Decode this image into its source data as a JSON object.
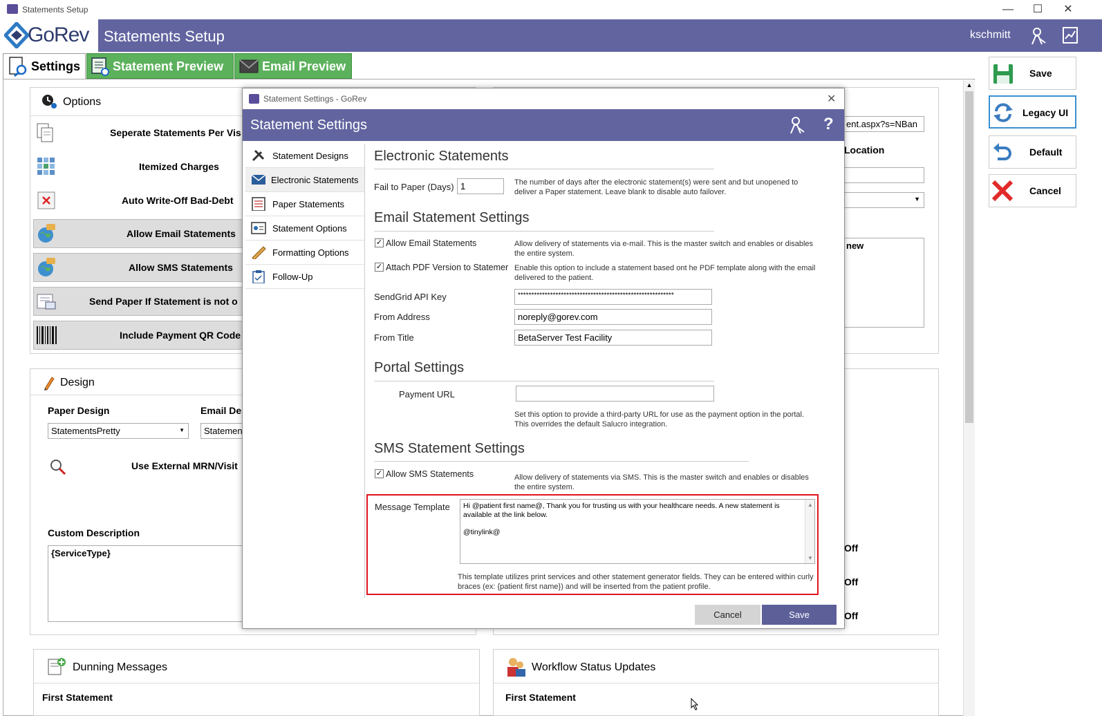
{
  "window": {
    "title": "Statements Setup",
    "min": "—",
    "max": "☐",
    "close": "✕"
  },
  "app": {
    "logo": "GoRev",
    "title": "Statements Setup",
    "username": "kschmitt"
  },
  "tabs": [
    {
      "label": "Settings"
    },
    {
      "label": "Statement Preview"
    },
    {
      "label": "Email Preview"
    }
  ],
  "options_panel": {
    "title": "Options",
    "items": [
      {
        "label": "Seperate Statements Per Vis"
      },
      {
        "label": "Itemized Charges"
      },
      {
        "label": "Auto Write-Off Bad-Debt"
      },
      {
        "label": "Allow Email Statements"
      },
      {
        "label": "Allow SMS Statements"
      },
      {
        "label": "Send Paper If Statement is not o"
      },
      {
        "label": "Include Payment QR Code"
      }
    ]
  },
  "design_panel": {
    "title": "Design",
    "paper_design_label": "Paper Design",
    "paper_design_value": "StatementsPretty",
    "email_design_label": "Email Des",
    "email_design_value": "Statemen",
    "external_mrn_label": "Use External MRN/Visit",
    "custom_description_label": "Custom Description",
    "custom_description_value": "{ServiceType}"
  },
  "right_partial": {
    "url_value": "ent.aspx?s=NBan",
    "location_label": "Location",
    "textarea_fragment": "new",
    "off1": "Off",
    "off2": "Off",
    "off3": "Off"
  },
  "dunning": {
    "title": "Dunning Messages",
    "first": "First Statement"
  },
  "workflow": {
    "title": "Workflow Status Updates",
    "first": "First Statement"
  },
  "side_buttons": {
    "save": "Save",
    "legacy": "Legacy UI",
    "default": "Default",
    "cancel": "Cancel"
  },
  "dialog": {
    "window_title": "Statement Settings - GoRev",
    "header": "Statement Settings",
    "help": "?",
    "nav": [
      {
        "label": "Statement Designs"
      },
      {
        "label": "Electronic Statements"
      },
      {
        "label": "Paper Statements"
      },
      {
        "label": "Statement Options"
      },
      {
        "label": "Formatting Options"
      },
      {
        "label": "Follow-Up"
      }
    ],
    "electronic": {
      "title": "Electronic Statements",
      "fail_label": "Fail to Paper (Days)",
      "fail_value": "1",
      "fail_help": "The number of days after the electronic statement(s) were sent and but unopened to deliver a Paper statement. Leave blank to disable auto failover."
    },
    "email": {
      "title": "Email Statement Settings",
      "allow_label": "Allow Email Statements",
      "allow_help": "Allow delivery of statements via e-mail. This is the master switch and enables or disables the entire system.",
      "pdf_label": "Attach PDF Version to Statemer",
      "pdf_help": "Enable this option to include a statement based ont he PDF template along with the email delivered to the patient.",
      "sendgrid_label": "SendGrid API Key",
      "sendgrid_value": "**********************************************************",
      "from_address_label": "From Address",
      "from_address_value": "noreply@gorev.com",
      "from_title_label": "From Title",
      "from_title_value": "BetaServer Test Facility"
    },
    "portal": {
      "title": "Portal Settings",
      "payment_label": "Payment URL",
      "payment_value": "",
      "payment_help": "Set this option to provide a third-party URL for use as the payment option in the portal. This overrides the default Salucro integration."
    },
    "sms": {
      "title": "SMS Statement Settings",
      "allow_label": "Allow SMS Statements",
      "allow_help": "Allow delivery of statements via SMS. This is the master switch and enables or disables the entire system.",
      "template_label": "Message Template",
      "template_line1": "Hi @patient first name@, Thank you for trusting us with your healthcare needs. A new statement is available at the link below.",
      "template_line2": "@tinylink@",
      "template_help": "This template utilizes print services and other statement generator fields. They can be entered within curly braces (ex: {patient first name}) and will be inserted from the patient profile."
    },
    "cancel": "Cancel",
    "save": "Save"
  },
  "colors": {
    "header": "#6264a0",
    "tab_green": "#5cb15c",
    "highlight_border": "#e0141e",
    "dlg_save": "#5d5f99",
    "dlg_cancel": "#d4d4d4"
  }
}
